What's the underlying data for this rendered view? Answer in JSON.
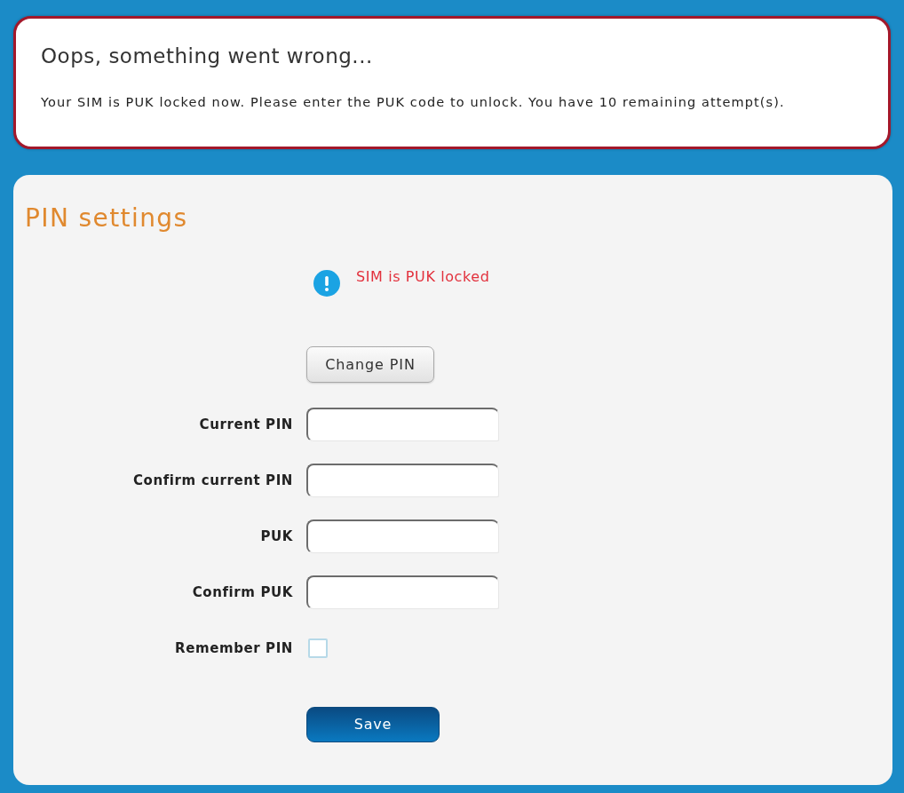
{
  "error": {
    "title": "Oops, something went wrong...",
    "message": "Your SIM is PUK locked now. Please enter the PUK code to unlock. You have 10 remaining attempt(s)."
  },
  "panel": {
    "title": "PIN settings",
    "status": "SIM is PUK locked",
    "change_button": "Change PIN",
    "fields": [
      {
        "label": "Current PIN",
        "kind": "text"
      },
      {
        "label": "Confirm current PIN",
        "kind": "text"
      },
      {
        "label": "PUK",
        "kind": "text"
      },
      {
        "label": "Confirm PUK",
        "kind": "text"
      },
      {
        "label": "Remember PIN",
        "kind": "checkbox",
        "checked": false
      }
    ],
    "save_button": "Save"
  }
}
